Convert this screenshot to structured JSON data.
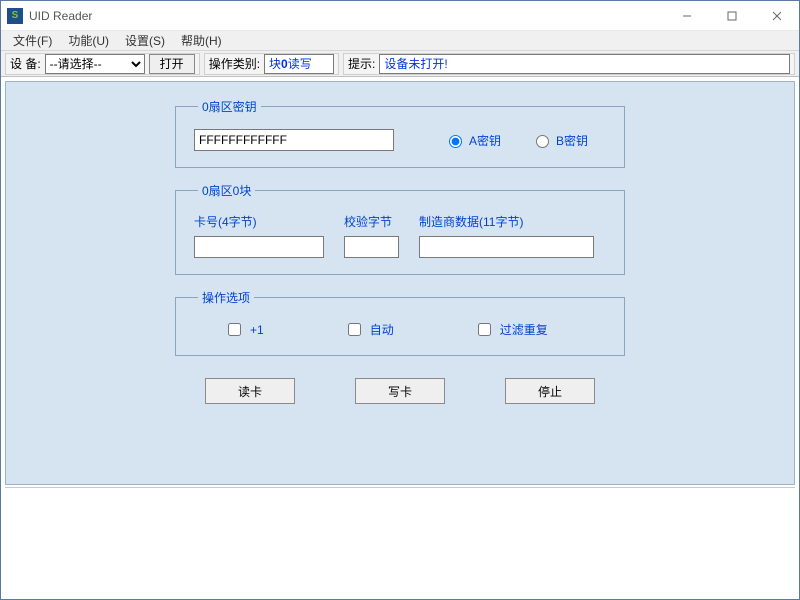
{
  "window": {
    "title": "UID Reader"
  },
  "menu": {
    "file": "文件(F)",
    "func": "功能(U)",
    "settings": "设置(S)",
    "help": "帮助(H)"
  },
  "toolbar": {
    "device_label": "设  备:",
    "device_selected": "--请选择--",
    "open_btn": "打开",
    "op_type_label": "操作类别:",
    "op_type_prefix": "块",
    "op_type_bold": "0",
    "op_type_suffix": "读写",
    "hint_label": "提示:",
    "hint_value": "设备未打开!"
  },
  "group_key": {
    "legend": "0扇区密钥",
    "key_value": "FFFFFFFFFFFF",
    "radio_a": "A密钥",
    "radio_b": "B密钥",
    "selected": "a"
  },
  "group_block": {
    "legend": "0扇区0块",
    "card_label": "卡号(4字节)",
    "check_label": "校验字节",
    "mfr_label": "制造商数据(11字节)",
    "card_value": "",
    "check_value": "",
    "mfr_value": ""
  },
  "group_opts": {
    "legend": "操作选项",
    "plus1": "+1",
    "auto": "自动",
    "filter": "过滤重复",
    "plus1_checked": false,
    "auto_checked": false,
    "filter_checked": false
  },
  "actions": {
    "read": "读卡",
    "write": "写卡",
    "stop": "停止"
  }
}
